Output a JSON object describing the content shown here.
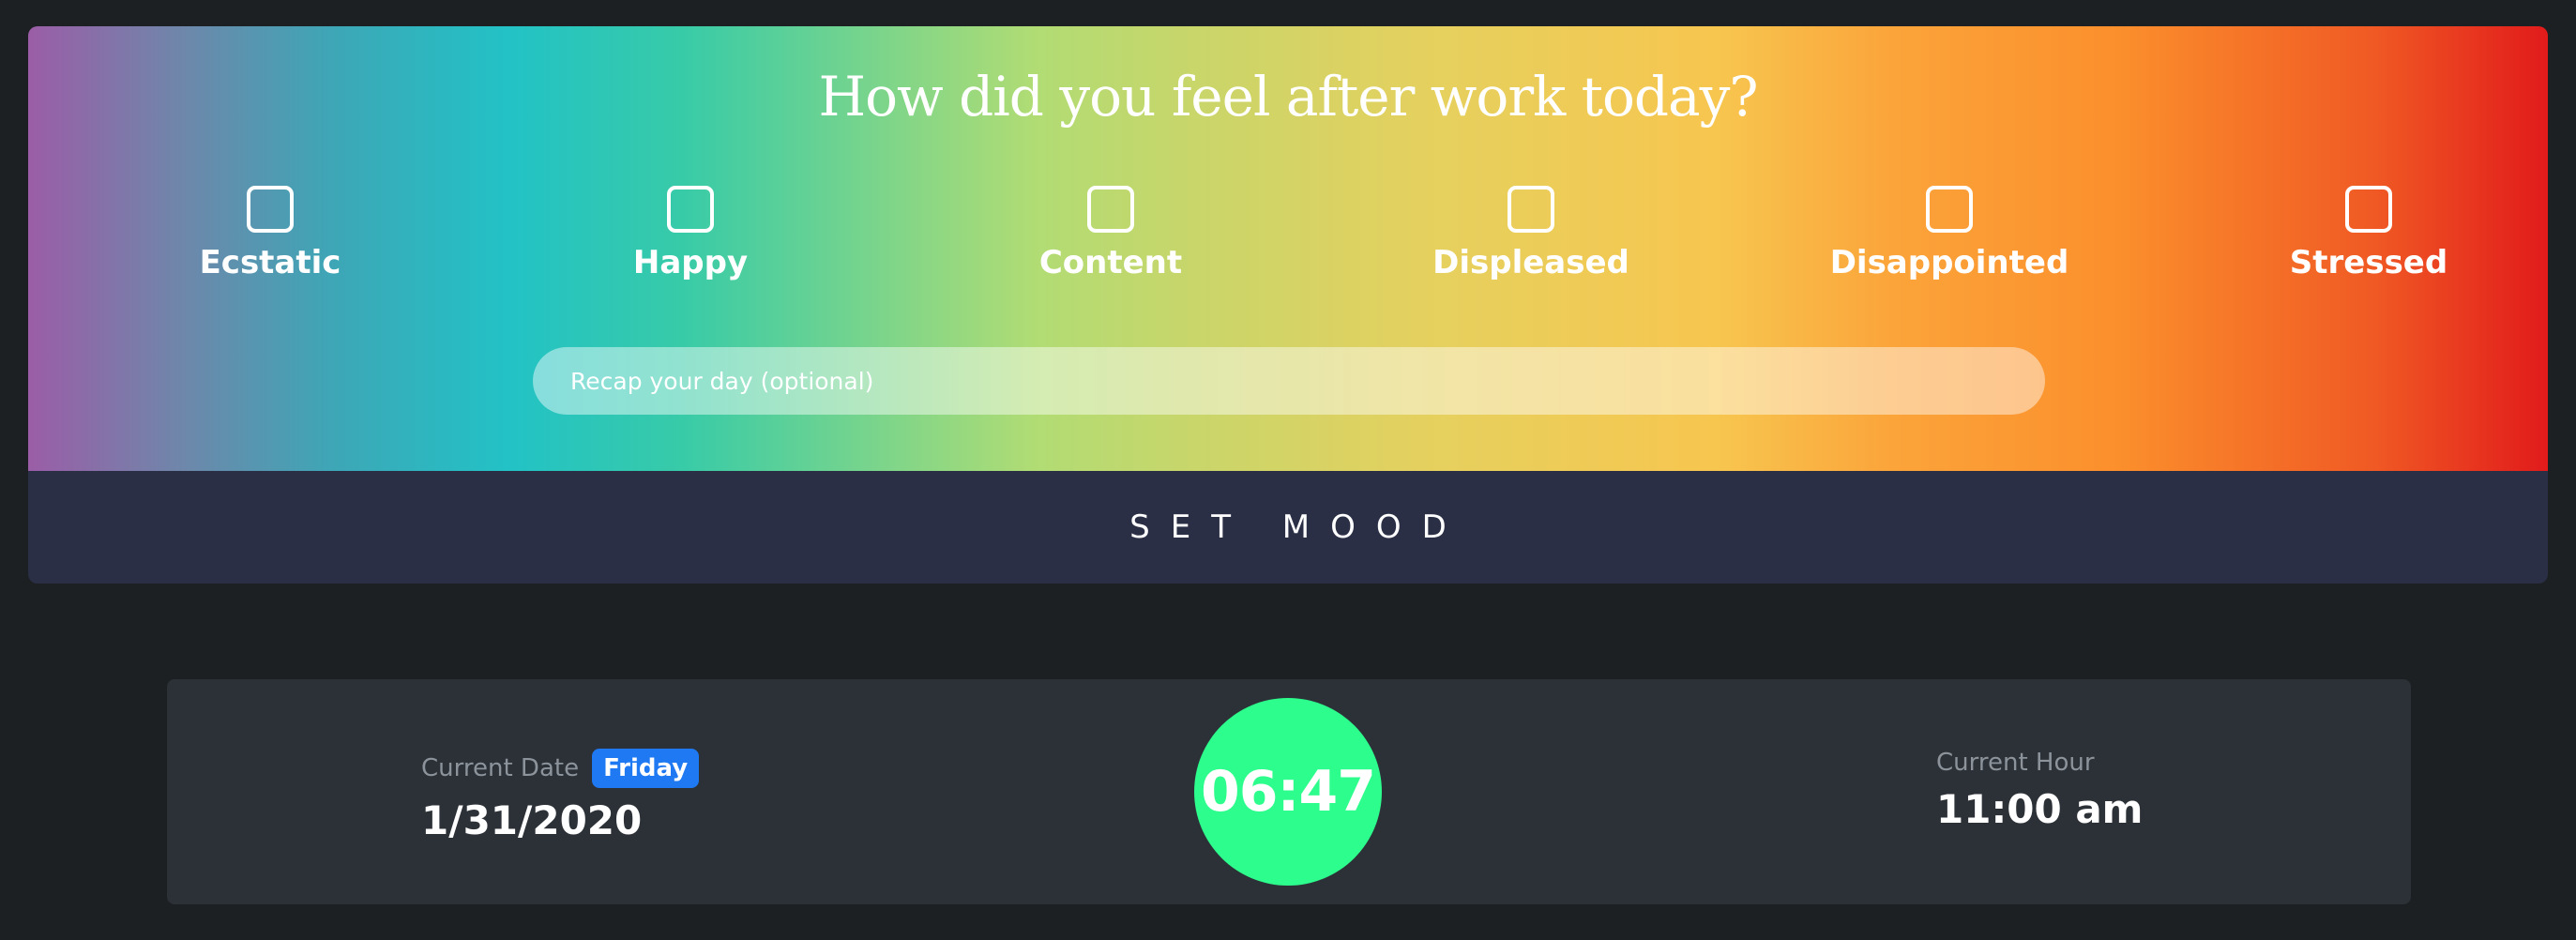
{
  "mood": {
    "title": "How did you feel after work today?",
    "options": [
      {
        "label": "Ecstatic",
        "checked": false
      },
      {
        "label": "Happy",
        "checked": false
      },
      {
        "label": "Content",
        "checked": false
      },
      {
        "label": "Displeased",
        "checked": false
      },
      {
        "label": "Disappointed",
        "checked": false
      },
      {
        "label": "Stressed",
        "checked": false
      }
    ],
    "recap_placeholder": "Recap your day (optional)",
    "recap_value": "",
    "submit_label": "SET MOOD"
  },
  "status": {
    "date_caption": "Current Date",
    "day_badge": "Friday",
    "date_value": "1/31/2020",
    "timer": "06:47",
    "hour_caption": "Current Hour",
    "hour_value": "11:00 am"
  },
  "colors": {
    "page_background": "#1d2023",
    "submit_bar": "#2a2f46",
    "status_card": "#2c3137",
    "timer_circle": "#2dfd8c",
    "day_badge": "#1f79f2",
    "gradient_stops": [
      "#9b5da7",
      "#22c2c6",
      "#b1dc74",
      "#f7c64f",
      "#fb8f2c",
      "#e11b1b"
    ]
  }
}
